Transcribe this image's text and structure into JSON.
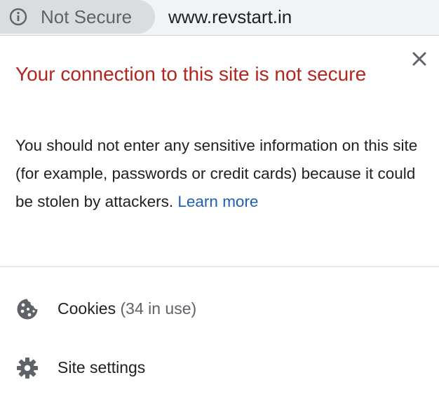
{
  "address_bar": {
    "security_label": "Not Secure",
    "url": "www.revstart.in",
    "security_icon": "info-icon"
  },
  "popup": {
    "title": "Your connection to this site is not secure",
    "body": "You should not enter any sensitive information on this site (for example, passwords or credit cards) because it could be stolen by attackers.",
    "learn_more": "Learn more",
    "close_icon": "close-icon",
    "items": [
      {
        "label": "Cookies",
        "detail": "(34 in use)",
        "icon": "cookie-icon"
      },
      {
        "label": "Site settings",
        "icon": "gear-icon"
      }
    ]
  },
  "colors": {
    "warning_title": "#b3261e",
    "link": "#1f5fb8",
    "chip_background": "#dadce0",
    "text": "#202124",
    "icon": "#5f6368"
  }
}
